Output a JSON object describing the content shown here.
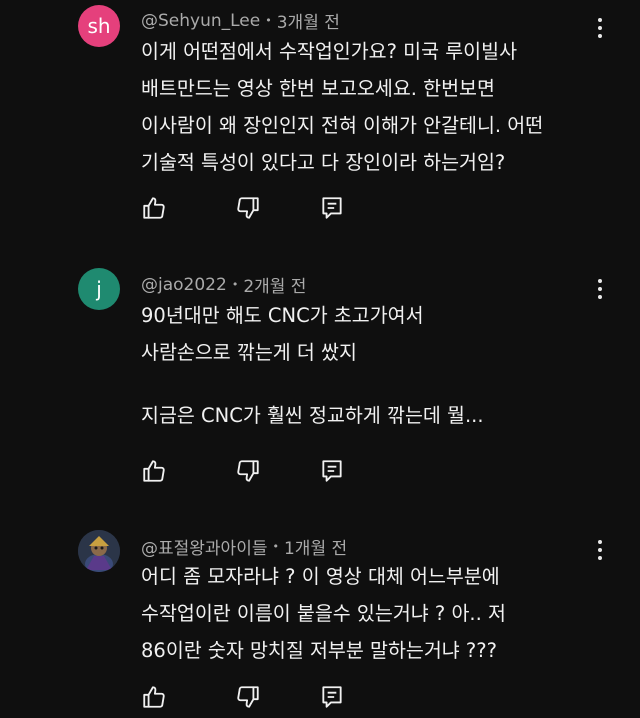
{
  "comments": [
    {
      "avatar_text": "sh",
      "avatar_color": "#e5407c",
      "author": "@Sehyun_Lee",
      "separator": "•",
      "time": "3개월 전",
      "lines": [
        "이게 어떤점에서 수작업인가요? 미국 루이빌사",
        "배트만드는 영상 한번 보고오세요. 한번보면",
        "이사람이 왜 장인인지 전혀 이해가 안갈테니. 어떤",
        "기술적 특성이 있다고 다 장인이라 하는거임?"
      ]
    },
    {
      "avatar_text": "j",
      "avatar_color": "#1f8a70",
      "author": "@jao2022",
      "separator": "•",
      "time": "2개월 전",
      "lines": [
        "90년대만 해도 CNC가 초고가여서",
        "사람손으로 깎는게 더 쌌지",
        "",
        "지금은 CNC가 훨씬 정교하게 깎는데 뭘..."
      ]
    },
    {
      "avatar_text": "",
      "avatar_color": "#2b3548",
      "author": "@표절왕과아이들",
      "separator": "•",
      "time": "1개월 전",
      "lines": [
        "어디 좀 모자라냐 ? 이 영상 대체 어느부분에",
        "수작업이란 이름이 붙을수 있는거냐 ? 아.. 저",
        "86이란 숫자 망치질 저부분 말하는거냐 ???"
      ]
    }
  ],
  "icons": {
    "like": "thumbs-up-icon",
    "dislike": "thumbs-down-icon",
    "reply": "reply-icon",
    "menu": "more-vertical-icon"
  }
}
